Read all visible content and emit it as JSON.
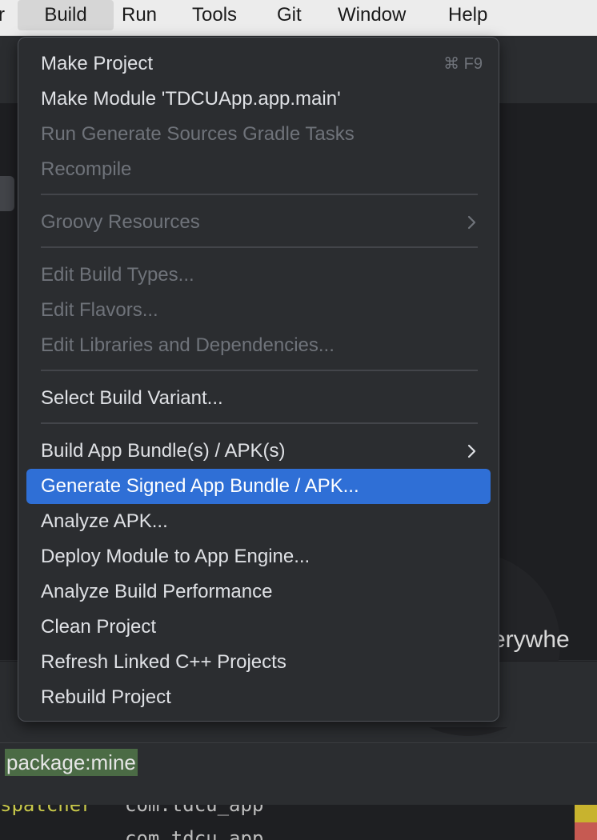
{
  "menubar": {
    "items": [
      {
        "label": "r"
      },
      {
        "label": "Build"
      },
      {
        "label": "Run"
      },
      {
        "label": "Tools"
      },
      {
        "label": "Git"
      },
      {
        "label": "Window"
      },
      {
        "label": "Help"
      }
    ]
  },
  "build_menu": {
    "items": [
      {
        "label": "Make Project",
        "shortcut": "⌘ F9",
        "enabled": true
      },
      {
        "label": "Make Module 'TDCUApp.app.main'",
        "enabled": true
      },
      {
        "label": "Run Generate Sources Gradle Tasks",
        "enabled": false
      },
      {
        "label": "Recompile",
        "enabled": false
      },
      {
        "label": "Groovy Resources",
        "enabled": false,
        "submenu": true
      },
      {
        "label": "Edit Build Types...",
        "enabled": false
      },
      {
        "label": "Edit Flavors...",
        "enabled": false
      },
      {
        "label": "Edit Libraries and Dependencies...",
        "enabled": false
      },
      {
        "label": "Select Build Variant...",
        "enabled": true
      },
      {
        "label": "Build App Bundle(s) / APK(s)",
        "enabled": true,
        "submenu": true
      },
      {
        "label": "Generate Signed App Bundle / APK...",
        "enabled": true,
        "selected": true
      },
      {
        "label": "Analyze APK...",
        "enabled": true
      },
      {
        "label": "Deploy Module to App Engine...",
        "enabled": true
      },
      {
        "label": "Analyze Build Performance",
        "enabled": true
      },
      {
        "label": "Clean Project",
        "enabled": true
      },
      {
        "label": "Refresh Linked C++ Projects",
        "enabled": true
      },
      {
        "label": "Rebuild Project",
        "enabled": true
      }
    ]
  },
  "background": {
    "editor_text": "verywhe",
    "filter_value": "package:mine",
    "log_tag": "spatcher",
    "log_package_1": "com.tdcu_app",
    "log_package_2": "com.tdcu_app"
  },
  "colors": {
    "selection": "#2f6fd6",
    "menu_background": "#2b2d30",
    "disabled_text": "#6f737a",
    "filter_highlight": "#4b6b45"
  }
}
